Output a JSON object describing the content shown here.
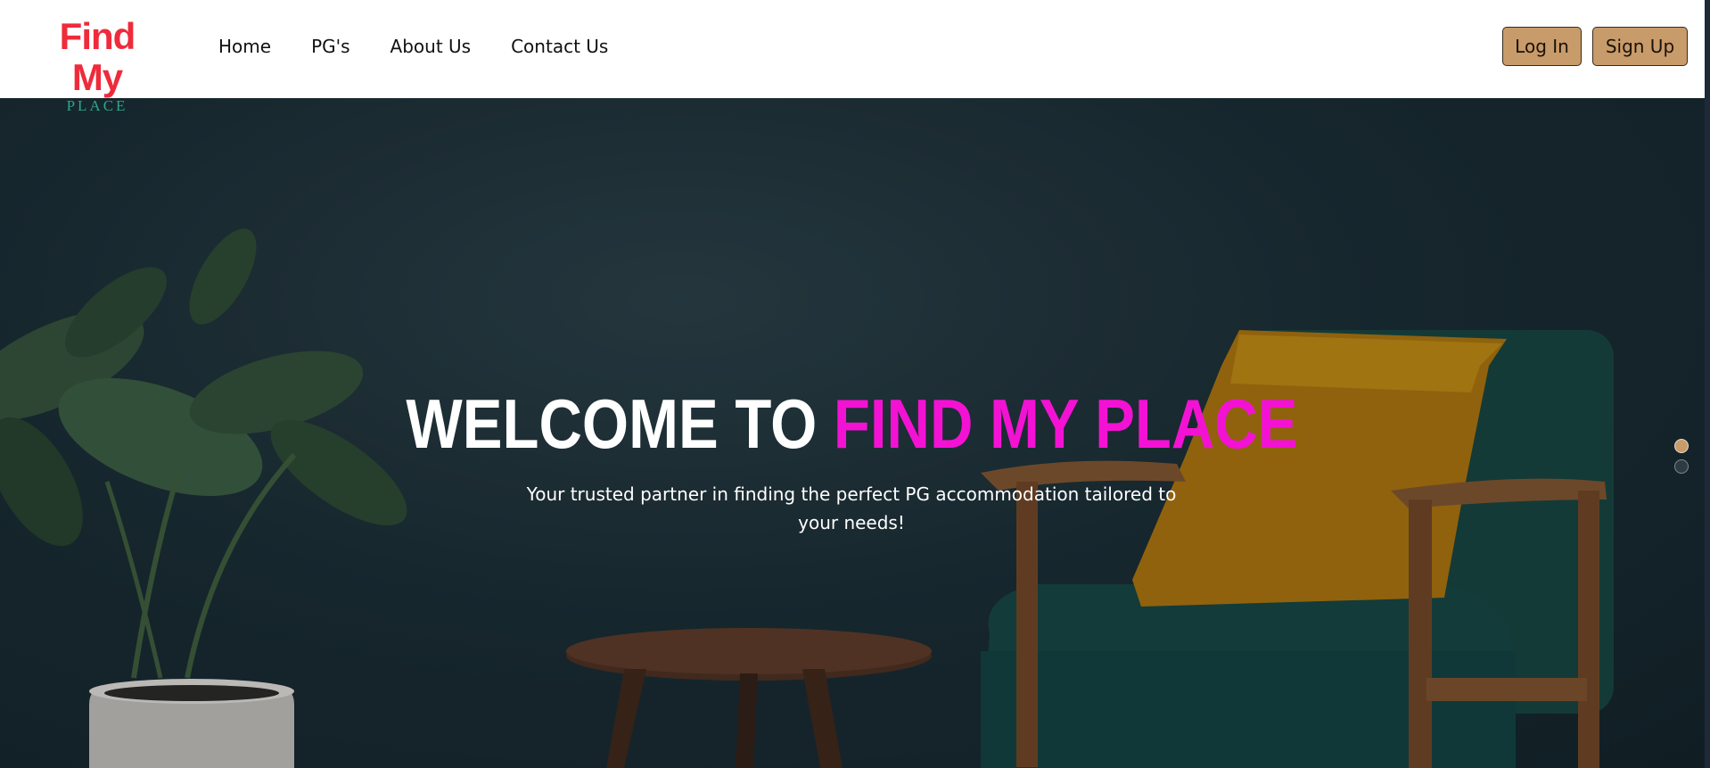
{
  "brand": {
    "logo_main": "Find My",
    "logo_sub": "PLACE"
  },
  "nav": {
    "items": [
      {
        "label": "Home"
      },
      {
        "label": "PG's"
      },
      {
        "label": "About Us"
      },
      {
        "label": "Contact Us"
      }
    ]
  },
  "auth": {
    "login_label": "Log In",
    "signup_label": "Sign Up"
  },
  "hero": {
    "title_prefix": "WELCOME TO",
    "title_highlight": "FIND MY PLACE",
    "subtitle": "Your trusted partner in finding the perfect PG accommodation tailored to your needs!"
  },
  "carousel": {
    "slide_count": 2,
    "active_index": 0
  },
  "colors": {
    "accent": "#c89b6a",
    "brand_red": "#ef2b3b",
    "brand_teal": "#2ea58c",
    "highlight": "#f312d4"
  }
}
